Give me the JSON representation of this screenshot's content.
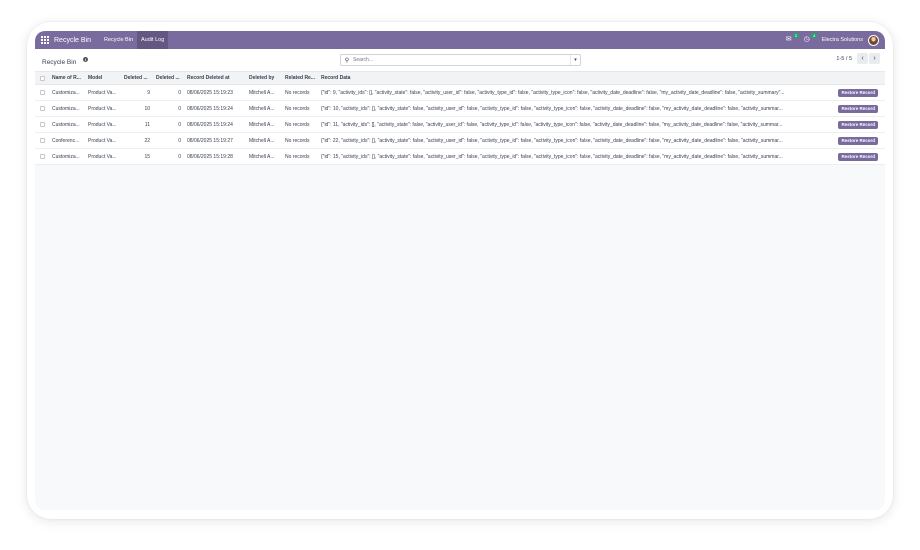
{
  "navbar": {
    "app_name": "Recycle Bin",
    "menu": [
      "Recycle Bin",
      "Audit Log"
    ],
    "active_menu_index": 1,
    "messages_badge": "2",
    "activity_badge": "4",
    "company": "Electra Solutions",
    "accent_color": "#7a6b9e"
  },
  "control": {
    "title": "Recycle Bin",
    "search_placeholder": "Search...",
    "pager": "1-5 / 5"
  },
  "table": {
    "headers": [
      "Name of R...",
      "Model",
      "Deleted ...",
      "Deleted ...",
      "Record Deleted at",
      "Deleted by",
      "Related Re...",
      "Record Data"
    ],
    "action_label": "Restore Record",
    "rows": [
      {
        "name": "Customiza...",
        "model": "Product Va...",
        "deleted_id": "9",
        "deleted2": "0",
        "date": "08/06/2025 15:19:23",
        "by": "Mitchell A...",
        "related": "No records",
        "data": "{\"id\": 9, \"activity_ids\": [], \"activity_state\": false, \"activity_user_id\": false, \"activity_type_id\": false, \"activity_type_icon\": false, \"activity_date_deadline\": false, \"my_activity_date_deadline\": false, \"activity_summary\"..."
      },
      {
        "name": "Customiza...",
        "model": "Product Va...",
        "deleted_id": "10",
        "deleted2": "0",
        "date": "08/06/2025 15:19:24",
        "by": "Mitchell A...",
        "related": "No records",
        "data": "{\"id\": 10, \"activity_ids\": [], \"activity_state\": false, \"activity_user_id\": false, \"activity_type_id\": false, \"activity_type_icon\": false, \"activity_date_deadline\": false, \"my_activity_date_deadline\": false, \"activity_summar..."
      },
      {
        "name": "Customiza...",
        "model": "Product Va...",
        "deleted_id": "11",
        "deleted2": "0",
        "date": "08/06/2025 15:19:24",
        "by": "Mitchell A...",
        "related": "No records",
        "data": "{\"id\": 11, \"activity_ids\": [], \"activity_state\": false, \"activity_user_id\": false, \"activity_type_id\": false, \"activity_type_icon\": false, \"activity_date_deadline\": false, \"my_activity_date_deadline\": false, \"activity_summar..."
      },
      {
        "name": "Conferenc...",
        "model": "Product Va...",
        "deleted_id": "22",
        "deleted2": "0",
        "date": "08/06/2025 15:19:27",
        "by": "Mitchell A...",
        "related": "No records",
        "data": "{\"id\": 22, \"activity_ids\": [], \"activity_state\": false, \"activity_user_id\": false, \"activity_type_id\": false, \"activity_type_icon\": false, \"activity_date_deadline\": false, \"my_activity_date_deadline\": false, \"activity_summar..."
      },
      {
        "name": "Customiza...",
        "model": "Product Va...",
        "deleted_id": "15",
        "deleted2": "0",
        "date": "08/06/2025 15:19:28",
        "by": "Mitchell A...",
        "related": "No records",
        "data": "{\"id\": 15, \"activity_ids\": [], \"activity_state\": false, \"activity_user_id\": false, \"activity_type_id\": false, \"activity_type_icon\": false, \"activity_date_deadline\": false, \"my_activity_date_deadline\": false, \"activity_summar..."
      }
    ]
  }
}
